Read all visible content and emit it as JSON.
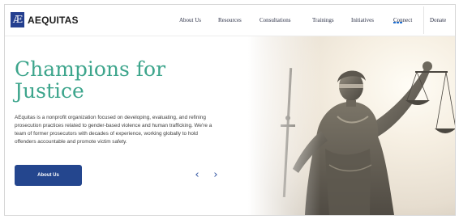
{
  "brand": {
    "logo_mark": "Æ",
    "name": "AEQUITAS"
  },
  "nav": {
    "items": [
      "About Us",
      "Resources",
      "Consultations",
      "Trainings",
      "Initiatives",
      "Connect",
      "Donate"
    ]
  },
  "hero": {
    "title_line1": "Champions for",
    "title_line2": "Justice",
    "description": "AEquitas is a nonprofit organization focused on developing, evaluating, and refining prosecution practices related to gender-based violence and human trafficking. We're a team of former prosecutors with decades of experience, working globally to hold offenders accountable and promote victim safety.",
    "cta_label": "About Us",
    "prev_arrow": "‹",
    "next_arrow": "›",
    "image_subject": "lady-justice-statue-photo"
  },
  "colors": {
    "brand_blue": "#243f8f",
    "title_green": "#3da58c",
    "button_blue": "#24468e",
    "accent_dots": "#1f6fd1"
  }
}
